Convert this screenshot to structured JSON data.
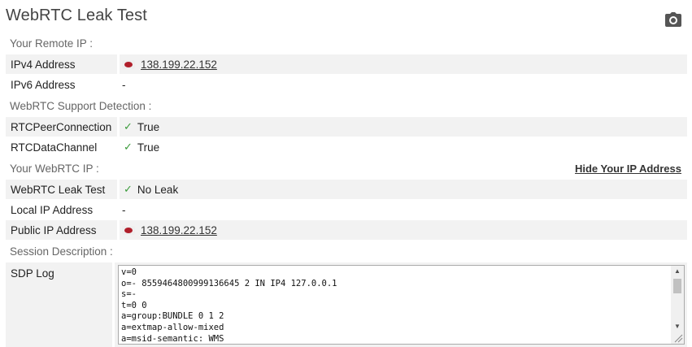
{
  "page": {
    "title": "WebRTC Leak Test",
    "camera_icon": "camera-icon"
  },
  "sections": {
    "remote": "Your Remote IP :",
    "support": "WebRTC Support Detection :",
    "webrtc_ip": "Your WebRTC IP :",
    "session": "Session Description :"
  },
  "remote": {
    "ipv4_label": "IPv4 Address",
    "ipv4_value": "138.199.22.152",
    "ipv6_label": "IPv6 Address",
    "ipv6_value": "-"
  },
  "support": {
    "peer_label": "RTCPeerConnection",
    "peer_value": "True",
    "data_label": "RTCDataChannel",
    "data_value": "True",
    "check": "✓"
  },
  "webrtc": {
    "hide_link": "Hide Your IP Address",
    "leak_label": "WebRTC Leak Test",
    "leak_value": "No Leak",
    "local_label": "Local IP Address",
    "local_value": "-",
    "public_label": "Public IP Address",
    "public_value": "138.199.22.152"
  },
  "sdp": {
    "label": "SDP Log",
    "text": "v=0\no=- 8559464800999136645 2 IN IP4 127.0.0.1\ns=-\nt=0 0\na=group:BUNDLE 0 1 2\na=extmap-allow-mixed\na=msid-semantic: WMS"
  },
  "colors": {
    "flag_red": "#b01f2b",
    "check_green": "#3a9b3a",
    "row_bg": "#f2f2f2"
  }
}
